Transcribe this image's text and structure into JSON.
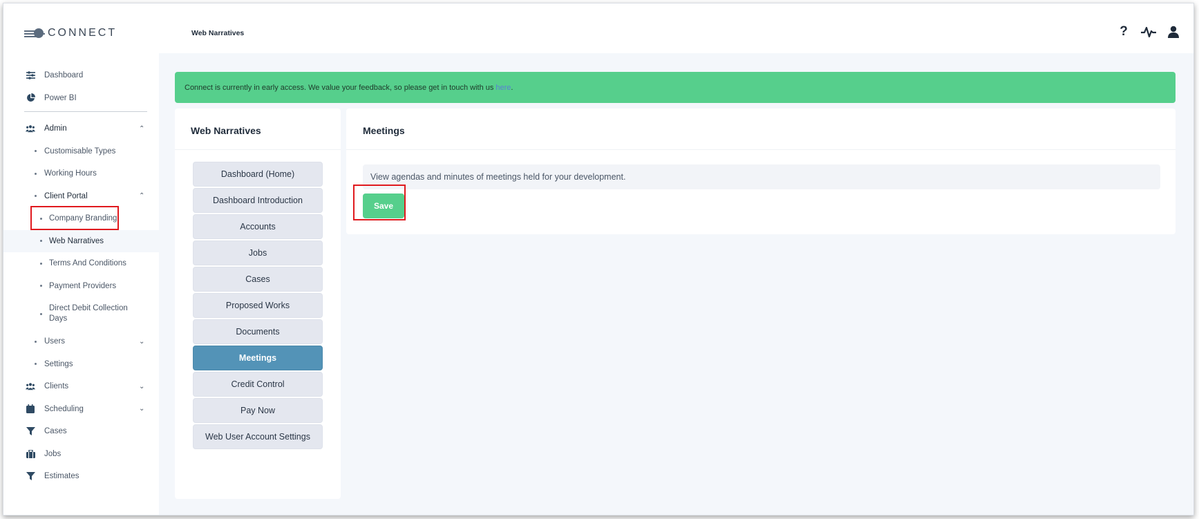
{
  "app": {
    "logo_text": "CONNECT"
  },
  "header": {
    "title": "Web Narratives",
    "icons": [
      "help-icon",
      "activity-icon",
      "user-icon"
    ]
  },
  "sidebar": {
    "items": [
      {
        "label": "Dashboard",
        "icon": "sliders-icon"
      },
      {
        "label": "Power BI",
        "icon": "pie-chart-icon"
      },
      {
        "label": "Admin",
        "icon": "users-icon",
        "expanded": true
      },
      {
        "label": "Customisable Types"
      },
      {
        "label": "Working Hours"
      },
      {
        "label": "Client Portal",
        "expanded": true
      },
      {
        "label": "Company Branding"
      },
      {
        "label": "Web Narratives",
        "active": true
      },
      {
        "label": "Terms And Conditions"
      },
      {
        "label": "Payment Providers"
      },
      {
        "label": "Direct Debit Collection Days"
      },
      {
        "label": "Users",
        "expanded": false
      },
      {
        "label": "Settings"
      },
      {
        "label": "Clients",
        "icon": "users-icon",
        "expanded": false
      },
      {
        "label": "Scheduling",
        "icon": "calendar-icon",
        "expanded": false
      },
      {
        "label": "Cases",
        "icon": "filter-icon"
      },
      {
        "label": "Jobs",
        "icon": "briefcase-icon"
      },
      {
        "label": "Estimates",
        "icon": "filter-icon"
      }
    ]
  },
  "banner": {
    "text": "Connect is currently in early access. We value your feedback, so please get in touch with us",
    "link_text": "here",
    "suffix": "."
  },
  "left_panel": {
    "title": "Web Narratives",
    "menu": [
      "Dashboard (Home)",
      "Dashboard Introduction",
      "Accounts",
      "Jobs",
      "Cases",
      "Proposed Works",
      "Documents",
      "Meetings",
      "Credit Control",
      "Pay Now",
      "Web User Account Settings"
    ],
    "selected": "Meetings"
  },
  "right_panel": {
    "title": "Meetings",
    "description": "View agendas and minutes of meetings held for your development.",
    "save_label": "Save"
  },
  "colors": {
    "banner": "#56cf8c",
    "selected_menu": "#5393b7",
    "save_button": "#56cf8c",
    "highlight": "#e0191e"
  }
}
